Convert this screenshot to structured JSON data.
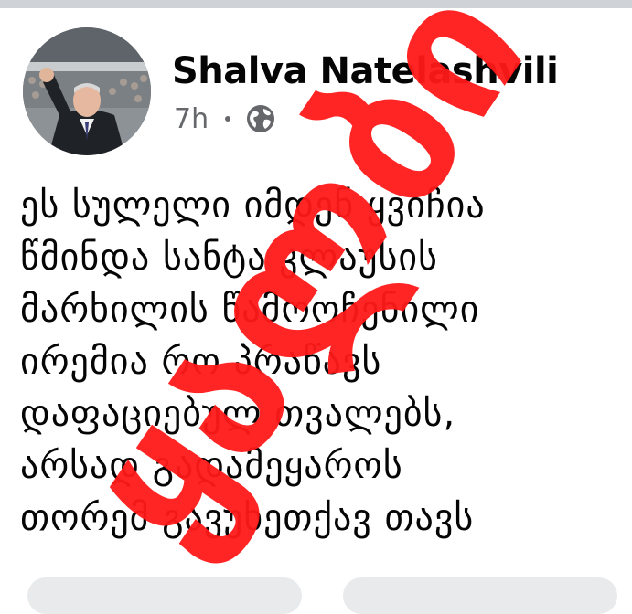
{
  "post": {
    "author": "Shalva Natelashvili",
    "time": "7h",
    "privacy_icon": "globe-icon",
    "lines": [
      "ეს სულელი იმდენ ყვიჩია",
      "წმინდა სანტა კლაუსის",
      "მარხილის წამოოჩენილი",
      "ირემია რო პრაწავს",
      "დაფაციებულ თვალებს,",
      "არსად გადამეყაროს",
      "თორემ გავუხეთქავ თავს"
    ]
  },
  "stamp": {
    "text": "ყალბი",
    "color": "#ff1a1a"
  },
  "colors": {
    "text": "#050505",
    "secondary": "#65676b",
    "background": "#ffffff"
  }
}
